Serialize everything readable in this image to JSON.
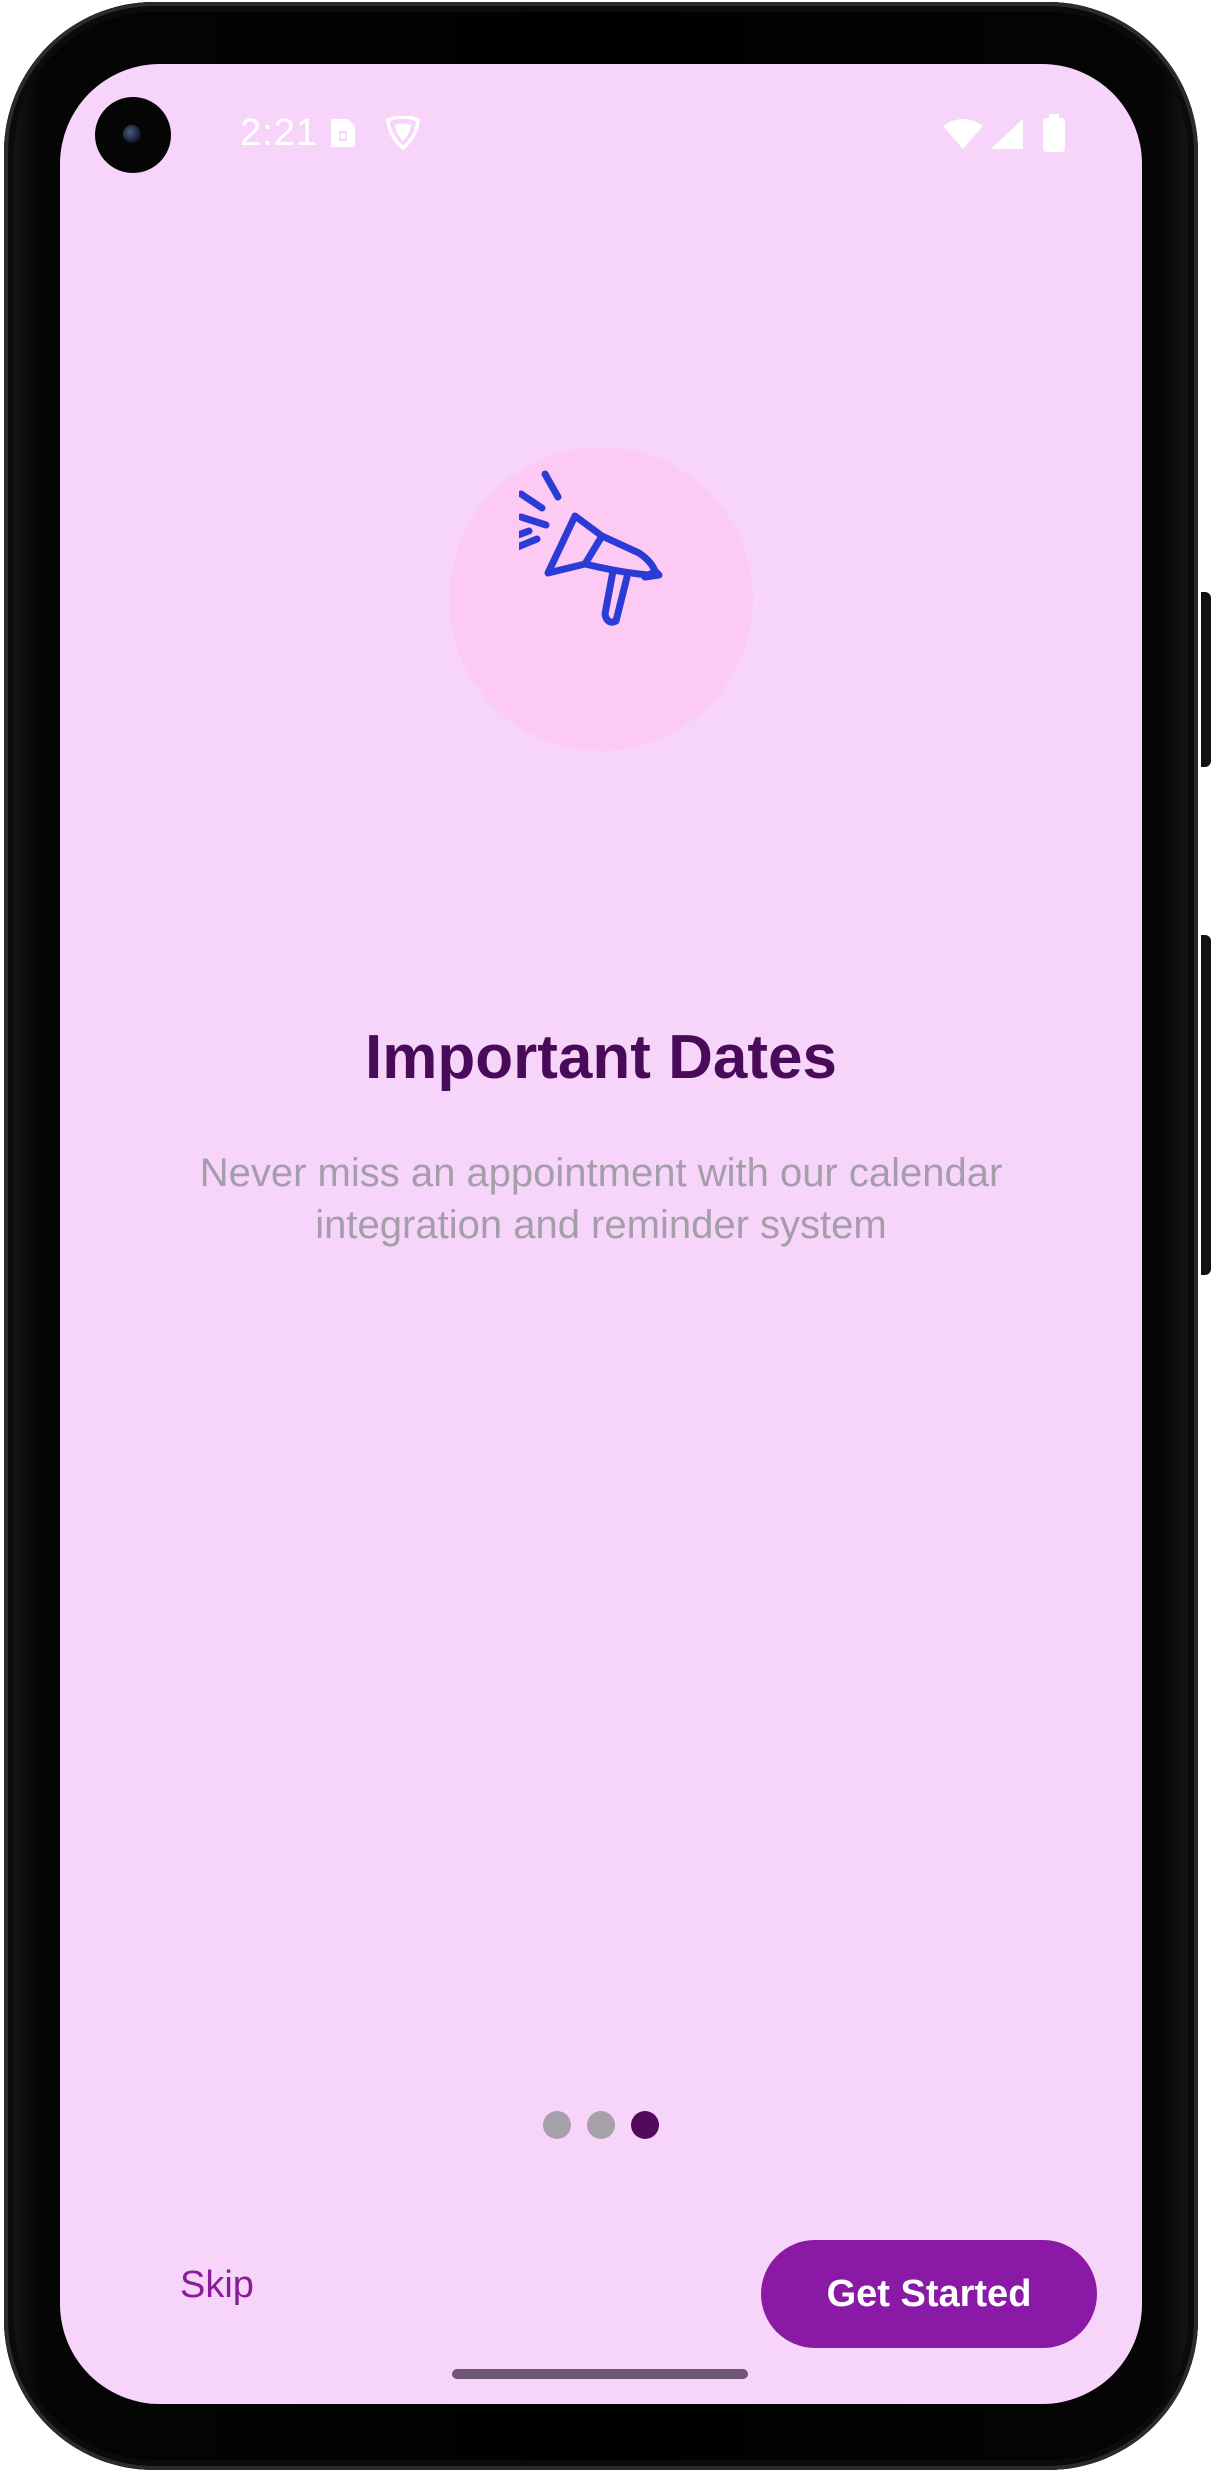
{
  "status_bar": {
    "time": "2:21",
    "icons": [
      "sim-card-icon",
      "shield-icon",
      "wifi-icon",
      "cellular-signal-icon",
      "battery-icon"
    ]
  },
  "onboarding": {
    "illustration": "megaphone-icon",
    "title": "Important Dates",
    "description": "Never miss an appointment with our calendar integration and reminder system",
    "pager": {
      "total": 3,
      "current": 3
    }
  },
  "actions": {
    "skip_label": "Skip",
    "get_started_label": "Get Started"
  },
  "colors": {
    "background": "#f7d5fb",
    "title": "#4a0a5a",
    "description": "#a39ea8",
    "accent": "#8a1aa6",
    "illustration_circle": "#fccaf2",
    "illustration_stroke": "#2b3cd6",
    "dot_inactive": "#a6a0a8",
    "dot_active": "#52095e"
  }
}
